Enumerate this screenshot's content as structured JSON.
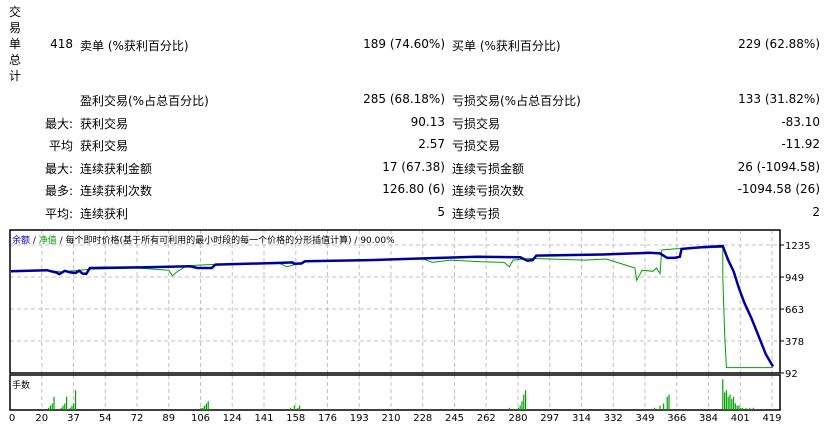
{
  "section_label": "交易单总计",
  "rows": [
    {
      "prefix": "418",
      "label1": "卖单 (%获利百分比)",
      "value1": "189 (74.60%)",
      "label2": "买单 (%获利百分比)",
      "value2": "229 (62.88%)"
    },
    {
      "prefix": "",
      "label1": "盈利交易(%占总百分比)",
      "value1": "285 (68.18%)",
      "label2": "亏损交易(%占总百分比)",
      "value2": "133 (31.82%)"
    },
    {
      "prefix": "最大:",
      "label1": "获利交易",
      "value1": "90.13",
      "label2": "亏损交易",
      "value2": "-83.10"
    },
    {
      "prefix": "平均",
      "label1": "获利交易",
      "value1": "2.57",
      "label2": "亏损交易",
      "value2": "-11.92"
    },
    {
      "prefix": "最大:",
      "label1": "连续获利金额",
      "value1": "17 (67.38)",
      "label2": "连续亏损金额",
      "value2": "26 (-1094.58)"
    },
    {
      "prefix": "最多:",
      "label1": "连续获利次数",
      "value1": "126.80 (6)",
      "label2": "连续亏损次数",
      "value2": "-1094.58 (26)"
    },
    {
      "prefix": "平均:",
      "label1": "连续获利",
      "value1": "5",
      "label2": "连续亏损",
      "value2": "2"
    }
  ],
  "chart": {
    "legend_balance": "余额",
    "legend_sep": " / ",
    "legend_equity": "净值",
    "legend_rest": " / 每个即时价格(基于所有可利用的最小时段的每一个价格的分形插值计算) / 90.00%",
    "volume_label": "手数",
    "colors": {
      "balance": "#0000a0",
      "equity": "#00a000",
      "grid": "#c0c0c0"
    },
    "y_ticks": [
      1235,
      949,
      663,
      378,
      92
    ],
    "x_ticks": [
      0,
      20,
      37,
      54,
      72,
      89,
      106,
      124,
      141,
      158,
      176,
      193,
      210,
      228,
      245,
      262,
      280,
      297,
      314,
      332,
      349,
      366,
      384,
      401,
      419
    ],
    "x_range": [
      0,
      425
    ],
    "y_range": [
      92,
      1235
    ],
    "balance": [
      [
        0,
        1000
      ],
      [
        20,
        1010
      ],
      [
        25,
        990
      ],
      [
        27,
        975
      ],
      [
        30,
        1005
      ],
      [
        33,
        990
      ],
      [
        36,
        985
      ],
      [
        38,
        1005
      ],
      [
        40,
        980
      ],
      [
        42,
        978
      ],
      [
        44,
        1030
      ],
      [
        72,
        1035
      ],
      [
        100,
        1045
      ],
      [
        104,
        1030
      ],
      [
        112,
        1030
      ],
      [
        114,
        1060
      ],
      [
        150,
        1075
      ],
      [
        157,
        1080
      ],
      [
        158,
        1068
      ],
      [
        162,
        1070
      ],
      [
        164,
        1090
      ],
      [
        200,
        1100
      ],
      [
        230,
        1115
      ],
      [
        260,
        1130
      ],
      [
        284,
        1125
      ],
      [
        288,
        1095
      ],
      [
        291,
        1100
      ],
      [
        293,
        1140
      ],
      [
        330,
        1150
      ],
      [
        356,
        1165
      ],
      [
        362,
        1160
      ],
      [
        366,
        1120
      ],
      [
        370,
        1120
      ],
      [
        373,
        1130
      ],
      [
        374,
        1200
      ],
      [
        385,
        1215
      ],
      [
        397,
        1225
      ],
      [
        400,
        1100
      ],
      [
        403,
        1000
      ],
      [
        406,
        850
      ],
      [
        409,
        720
      ],
      [
        413,
        580
      ],
      [
        417,
        420
      ],
      [
        421,
        260
      ],
      [
        425,
        150
      ]
    ],
    "equity": [
      [
        0,
        1000
      ],
      [
        20,
        1010
      ],
      [
        28,
        995
      ],
      [
        45,
        1020
      ],
      [
        70,
        1030
      ],
      [
        88,
        1010
      ],
      [
        90,
        960
      ],
      [
        93,
        1000
      ],
      [
        98,
        1050
      ],
      [
        110,
        1060
      ],
      [
        150,
        1070
      ],
      [
        154,
        1040
      ],
      [
        158,
        1060
      ],
      [
        164,
        1090
      ],
      [
        200,
        1100
      ],
      [
        230,
        1110
      ],
      [
        235,
        1080
      ],
      [
        245,
        1100
      ],
      [
        262,
        1085
      ],
      [
        275,
        1080
      ],
      [
        278,
        1040
      ],
      [
        280,
        1100
      ],
      [
        290,
        1115
      ],
      [
        300,
        1110
      ],
      [
        320,
        1100
      ],
      [
        332,
        1110
      ],
      [
        340,
        1070
      ],
      [
        348,
        1030
      ],
      [
        349,
        920
      ],
      [
        352,
        1010
      ],
      [
        358,
        1000
      ],
      [
        360,
        1030
      ],
      [
        362,
        980
      ],
      [
        363,
        1190
      ],
      [
        370,
        1200
      ],
      [
        397,
        1215
      ],
      [
        397,
        950
      ],
      [
        398,
        450
      ],
      [
        399,
        140
      ],
      [
        425,
        140
      ]
    ],
    "volume": [
      [
        21,
        1
      ],
      [
        22,
        2
      ],
      [
        23,
        3
      ],
      [
        24,
        6
      ],
      [
        28,
        1
      ],
      [
        29,
        2
      ],
      [
        30,
        3
      ],
      [
        31,
        6
      ],
      [
        33,
        1
      ],
      [
        34,
        2
      ],
      [
        35,
        3
      ],
      [
        36,
        9
      ],
      [
        106,
        1
      ],
      [
        107,
        1
      ],
      [
        108,
        2
      ],
      [
        109,
        3
      ],
      [
        110,
        4
      ],
      [
        156,
        1
      ],
      [
        158,
        2
      ],
      [
        160,
        1
      ],
      [
        161,
        2
      ],
      [
        278,
        1
      ],
      [
        283,
        1
      ],
      [
        284,
        2
      ],
      [
        285,
        4
      ],
      [
        286,
        7
      ],
      [
        287,
        9
      ],
      [
        359,
        1
      ],
      [
        362,
        2
      ],
      [
        364,
        3
      ],
      [
        366,
        6
      ],
      [
        367,
        7
      ],
      [
        397,
        14
      ],
      [
        398,
        8
      ],
      [
        399,
        9
      ],
      [
        400,
        6
      ],
      [
        401,
        7
      ],
      [
        402,
        5
      ],
      [
        403,
        6
      ],
      [
        404,
        3
      ],
      [
        405,
        2
      ],
      [
        406,
        2
      ],
      [
        407,
        1
      ],
      [
        408,
        1
      ],
      [
        410,
        1
      ],
      [
        412,
        1
      ],
      [
        414,
        1
      ]
    ]
  }
}
